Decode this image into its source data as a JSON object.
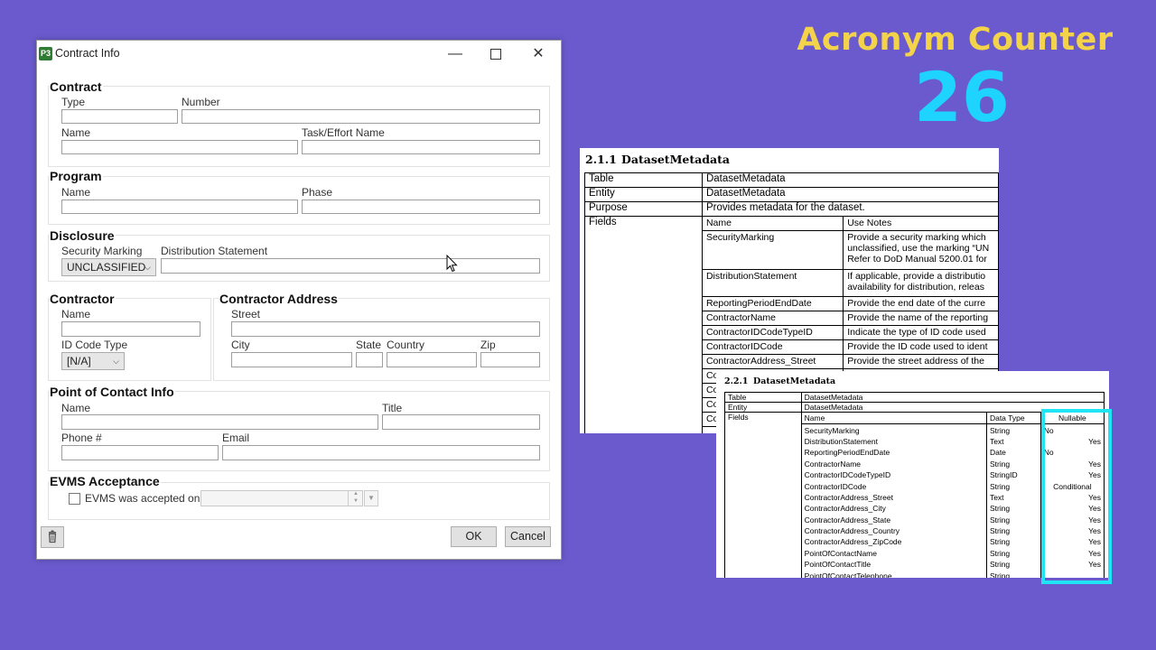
{
  "overlay": {
    "title": "Acronym Counter",
    "count": "26",
    "title_color": "#f3d34a",
    "count_color": "#1fd3ff"
  },
  "window": {
    "title": "Contract Info",
    "app_icon": "P3",
    "controls": {
      "minimize": "—",
      "close": "✕"
    }
  },
  "form": {
    "contract": {
      "title": "Contract",
      "type_label": "Type",
      "number_label": "Number",
      "name_label": "Name",
      "task_label": "Task/Effort Name"
    },
    "program": {
      "title": "Program",
      "name_label": "Name",
      "phase_label": "Phase"
    },
    "disclosure": {
      "title": "Disclosure",
      "security_label": "Security Marking",
      "security_value": "UNCLASSIFIED",
      "distribution_label": "Distribution Statement"
    },
    "contractor": {
      "title": "Contractor",
      "name_label": "Name",
      "id_code_type_label": "ID Code Type",
      "id_code_type_value": "[N/A]"
    },
    "address": {
      "title": "Contractor Address",
      "street_label": "Street",
      "city_label": "City",
      "state_label": "State",
      "country_label": "Country",
      "zip_label": "Zip"
    },
    "poc": {
      "title": "Point of Contact Info",
      "name_label": "Name",
      "title_label": "Title",
      "phone_label": "Phone #",
      "email_label": "Email"
    },
    "evms": {
      "title": "EVMS Acceptance",
      "checkbox_label": "EVMS was accepted on"
    },
    "buttons": {
      "ok": "OK",
      "cancel": "Cancel"
    }
  },
  "doc1": {
    "section_number": "2.1.1",
    "section_title": "DatasetMetadata",
    "rows": [
      {
        "key": "Table",
        "value": "DatasetMetadata"
      },
      {
        "key": "Entity",
        "value": "DatasetMetadata"
      },
      {
        "key": "Purpose",
        "value": "Provides metadata for the dataset."
      }
    ],
    "fields_label": "Fields",
    "columns": [
      "Name",
      "Use Notes"
    ],
    "fields": [
      {
        "name": "SecurityMarking",
        "notes": [
          "Provide a security marking which",
          "unclassified, use the marking “UN",
          "Refer to DoD Manual 5200.01 for"
        ]
      },
      {
        "name": "DistributionStatement",
        "notes": [
          "If applicable, provide a distributio",
          "availability for distribution, releas"
        ]
      },
      {
        "name": "ReportingPeriodEndDate",
        "notes": [
          "Provide the end date of the curre"
        ]
      },
      {
        "name": "ContractorName",
        "notes": [
          "Provide the name of the reporting"
        ]
      },
      {
        "name": "ContractorIDCodeTypeID",
        "notes": [
          "Indicate the type of ID code used"
        ]
      },
      {
        "name": "ContractorIDCode",
        "notes": [
          "Provide the ID code used to ident"
        ]
      },
      {
        "name": "ContractorAddress_Street",
        "notes": [
          "Provide the street address of the"
        ]
      },
      {
        "name": "Co",
        "notes": [
          ""
        ]
      },
      {
        "name": "Co",
        "notes": [
          ""
        ]
      },
      {
        "name": "Co",
        "notes": [
          ""
        ]
      },
      {
        "name": "Co",
        "notes": [
          ""
        ]
      }
    ]
  },
  "doc2": {
    "section_number": "2.2.1",
    "section_title": "DatasetMetadata",
    "rows": [
      {
        "key": "Table",
        "value": "DatasetMetadata"
      },
      {
        "key": "Entity",
        "value": "DatasetMetadata"
      }
    ],
    "fields_label": "Fields",
    "columns": [
      "Name",
      "Data Type",
      "Nullable"
    ],
    "fields": [
      {
        "name": "SecurityMarking",
        "type": "String",
        "nullable": "No"
      },
      {
        "name": "DistributionStatement",
        "type": "Text",
        "nullable": "Yes"
      },
      {
        "name": "ReportingPeriodEndDate",
        "type": "Date",
        "nullable": "No"
      },
      {
        "name": "ContractorName",
        "type": "String",
        "nullable": "Yes"
      },
      {
        "name": "ContractorIDCodeTypeID",
        "type": "StringID",
        "nullable": "Yes"
      },
      {
        "name": "ContractorIDCode",
        "type": "String",
        "nullable": "Conditional"
      },
      {
        "name": "ContractorAddress_Street",
        "type": "Text",
        "nullable": "Yes"
      },
      {
        "name": "ContractorAddress_City",
        "type": "String",
        "nullable": "Yes"
      },
      {
        "name": "ContractorAddress_State",
        "type": "String",
        "nullable": "Yes"
      },
      {
        "name": "ContractorAddress_Country",
        "type": "String",
        "nullable": "Yes"
      },
      {
        "name": "ContractorAddress_ZipCode",
        "type": "String",
        "nullable": "Yes"
      },
      {
        "name": "PointOfContactName",
        "type": "String",
        "nullable": "Yes"
      },
      {
        "name": "PointOfContactTitle",
        "type": "String",
        "nullable": "Yes"
      },
      {
        "name": "PointOfContactTelephone",
        "type": "String",
        "nullable": ""
      }
    ],
    "highlight_color": "#1fe4f4"
  }
}
